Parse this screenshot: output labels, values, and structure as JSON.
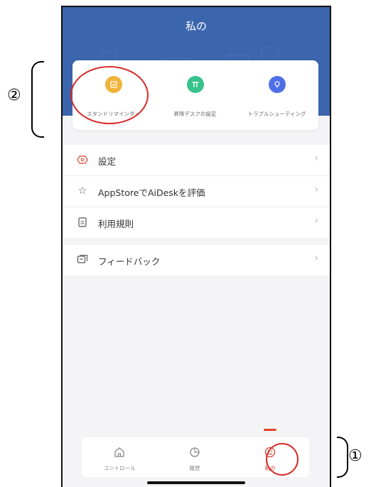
{
  "header": {
    "title": "私の"
  },
  "quick_actions": [
    {
      "label": "スタンドリマインダー",
      "icon": "reminder-icon",
      "color": "#f0b43a"
    },
    {
      "label": "昇降デスクの設定",
      "icon": "desk-icon",
      "color": "#36c28a"
    },
    {
      "label": "トラブルシューティング",
      "icon": "lightbulb-icon",
      "color": "#4f6fe8"
    }
  ],
  "menu": [
    {
      "label": "設定",
      "icon": "settings-icon"
    },
    {
      "label": "AppStoreでAiDeskを評価",
      "icon": "star-icon"
    },
    {
      "label": "利用規則",
      "icon": "document-icon"
    }
  ],
  "menu2": [
    {
      "label": "フィードバック",
      "icon": "feedback-icon"
    }
  ],
  "tabbar": [
    {
      "label": "コントロール",
      "icon": "home-icon",
      "active": false
    },
    {
      "label": "履歴",
      "icon": "history-icon",
      "active": false
    },
    {
      "label": "私の",
      "icon": "smile-icon",
      "active": true
    }
  ],
  "annotations": {
    "marker_1": "①",
    "marker_2": "②"
  },
  "colors": {
    "header_blue": "#3b65ad",
    "active_red": "#e0442b",
    "annotation_red": "#d82929"
  }
}
